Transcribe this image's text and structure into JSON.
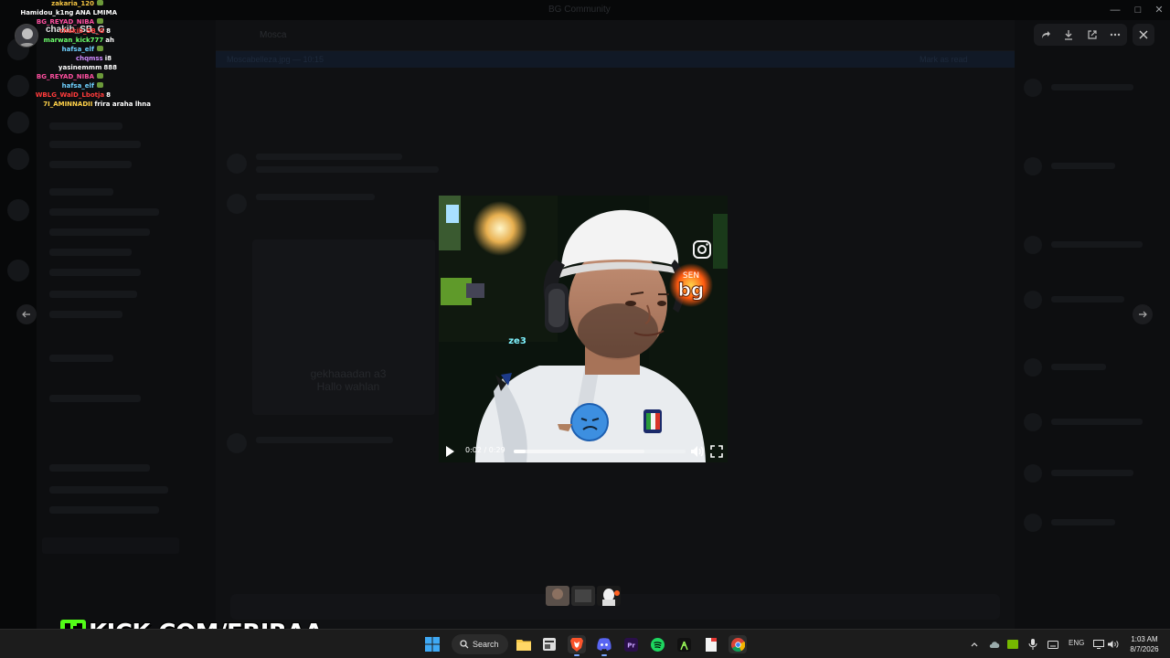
{
  "window": {
    "title": "BG Community"
  },
  "channel": {
    "name": "Mosca",
    "banner": "Moscabelleza.jpg — 10:15",
    "banner_action": "Mark as read"
  },
  "background_embed_text": "gekhaaadan a3 Hallo wahlan",
  "video": {
    "time": "0:02 / 0:29",
    "progress": 0.07,
    "buffered": 0.76
  },
  "overlay": {
    "username": "chakib_SB_G"
  },
  "stream_chat": [
    {
      "name": "zakaria_120",
      "color": "#f5c542",
      "msg": "",
      "badge": true
    },
    {
      "name": "Hamidou_k1ng",
      "color": "#ffffff",
      "msg": "ANA LMIMA",
      "badge": false
    },
    {
      "name": "BG_REYAD_NIBA",
      "color": "#ff4fa0",
      "msg": "",
      "badge": true
    },
    {
      "name": "chakib_SB_G",
      "color": "#ff4040",
      "msg": "8",
      "badge": false
    },
    {
      "name": "marwan_kick777",
      "color": "#6cff6c",
      "msg": "ah",
      "badge": false
    },
    {
      "name": "hafsa_elf",
      "color": "#6fd1ff",
      "msg": "",
      "badge": true
    },
    {
      "name": "chqmss",
      "color": "#d08bff",
      "msg": "i8",
      "badge": false
    },
    {
      "name": "yasinemmm",
      "color": "#ffffff",
      "msg": "888",
      "badge": false
    },
    {
      "name": "BG_REYAD_NIBA",
      "color": "#ff4fa0",
      "msg": "",
      "badge": true
    },
    {
      "name": "hafsa_elf",
      "color": "#6fd1ff",
      "msg": "",
      "badge": true
    },
    {
      "name": "WBLG_WalD_Lbotja",
      "color": "#ff3b3b",
      "msg": "8",
      "badge": false
    },
    {
      "name": "7I_AMINNADII",
      "color": "#ffd24a",
      "msg": "frira araha lhna",
      "badge": false
    }
  ],
  "kick_banner": "KICK.COM/FRIRAA",
  "taskbar": {
    "search_label": "Search",
    "language": "ENG",
    "time": "1:03 AM",
    "date": "8/7/2026"
  },
  "icons": {
    "start": "windows-start-icon",
    "search": "search-icon",
    "explorer": "folder-icon",
    "brave": "brave-browser-icon",
    "discord": "discord-icon",
    "premiere": "premiere-pro-icon",
    "spotify": "spotify-icon",
    "chrome": "chrome-icon"
  },
  "colors": {
    "kick_green": "#53fc18",
    "taskbar": "#1c1c1c",
    "accent": "#5865f2"
  }
}
